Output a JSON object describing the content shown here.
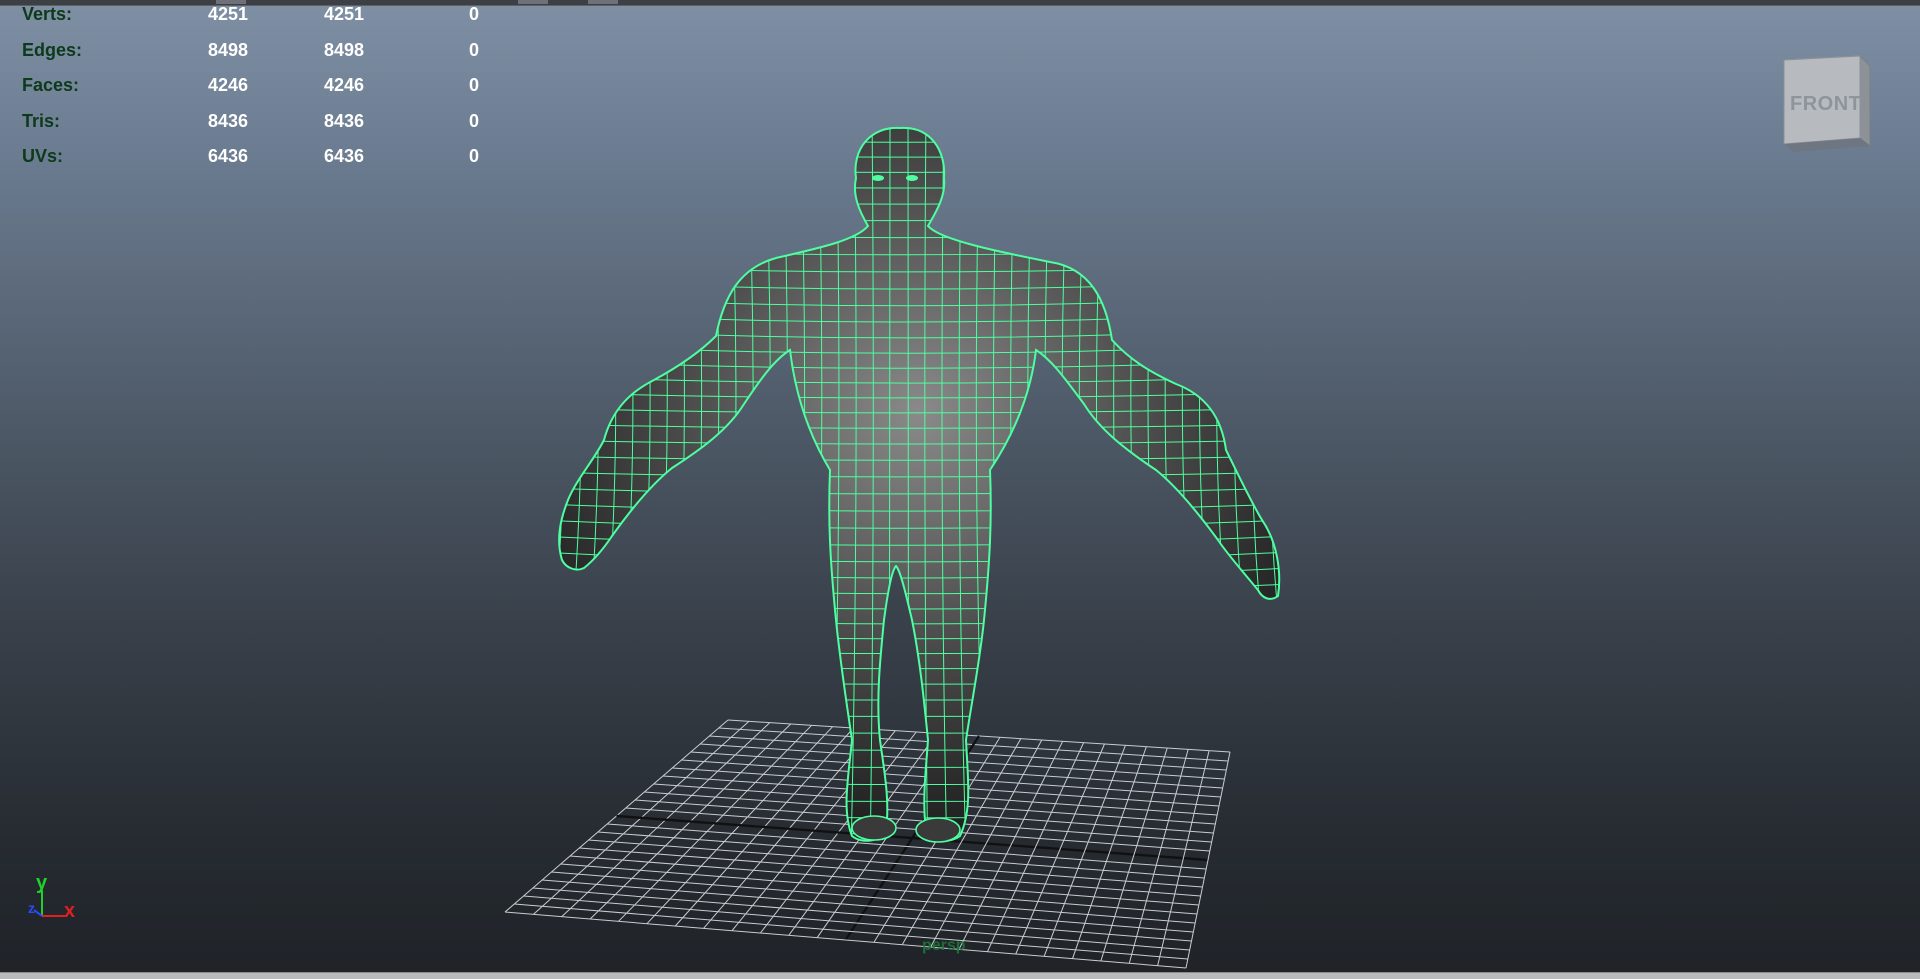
{
  "stats": {
    "rows": [
      {
        "label": "Verts:",
        "v1": "4251",
        "v2": "4251",
        "v3": "0"
      },
      {
        "label": "Edges:",
        "v1": "8498",
        "v2": "8498",
        "v3": "0"
      },
      {
        "label": "Faces:",
        "v1": "4246",
        "v2": "4246",
        "v3": "0"
      },
      {
        "label": "Tris:",
        "v1": "8436",
        "v2": "8436",
        "v3": "0"
      },
      {
        "label": "UVs:",
        "v1": "6436",
        "v2": "6436",
        "v3": "0"
      }
    ]
  },
  "viewcube": {
    "face_label": "FRONT"
  },
  "axis": {
    "y": "y",
    "x": "x",
    "z": "z"
  },
  "camera": {
    "label": "persp"
  },
  "colors": {
    "wireframe": "#4dffa0",
    "hud_label": "#0d3a1a",
    "axis_x": "#e02020",
    "axis_y": "#22d02a",
    "axis_z": "#2a4aff"
  },
  "icons": {
    "viewcube": "view-cube-icon",
    "axis": "axis-gizmo-icon"
  }
}
